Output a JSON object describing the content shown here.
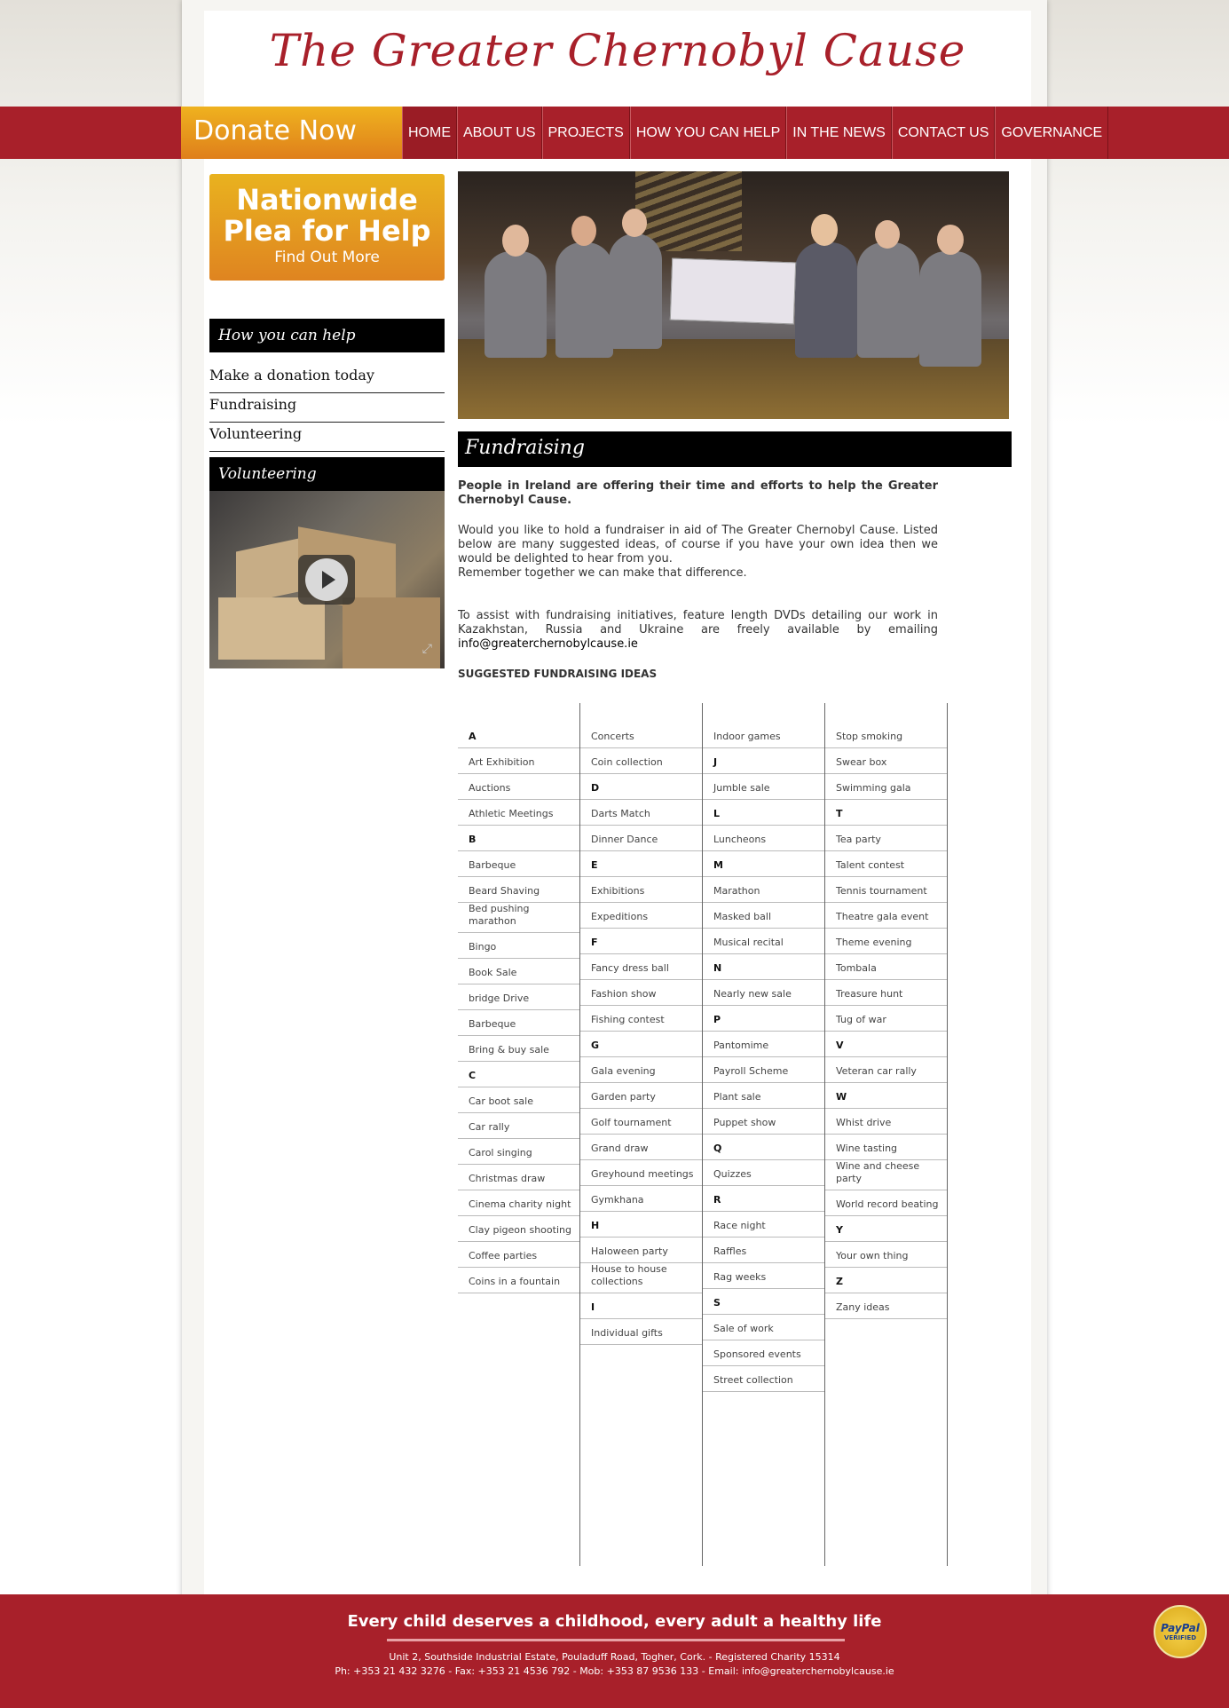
{
  "header": {
    "site_title": "The Greater Chernobyl Cause"
  },
  "nav": {
    "donate_label": "Donate Now",
    "items": [
      "HOME",
      "ABOUT US",
      "PROJECTS",
      "HOW YOU CAN HELP",
      "IN THE NEWS",
      "CONTACT US",
      "GOVERNANCE"
    ],
    "active": "HOME"
  },
  "sidebar": {
    "plea": {
      "title_line1": "Nationwide",
      "title_line2": "Plea for Help",
      "subtitle": "Find Out More"
    },
    "help_heading": "How you can help",
    "links": [
      "Make a donation today",
      "Fundraising",
      "Volunteering"
    ],
    "video_heading": "Volunteering"
  },
  "main": {
    "heading": "Fundraising",
    "lead": "People in Ireland are offering their time and efforts to help the Greater Chernobyl Cause.",
    "para1": "Would you like to hold a fundraiser in aid of The Greater Chernobyl Cause. Listed below are many suggested ideas, of course if you have your own idea then we would be delighted to hear from you.",
    "para2": "Remember together we can make that difference.",
    "para3": "To assist with fundraising initiatives, feature length DVDs detailing our work in Kazakhstan, Russia and Ukraine are freely available by emailing",
    "email": "info@greaterchernobylcause.ie",
    "ideas_title": "SUGGESTED FUNDRAISING IDEAS",
    "ideas_columns": [
      [
        "A",
        "Art Exhibition",
        "Auctions",
        "Athletic Meetings",
        "B",
        "Barbeque",
        "Beard Shaving",
        "Bed pushing marathon",
        "Bingo",
        "Book Sale",
        "bridge Drive",
        "Barbeque",
        "Bring & buy sale",
        "C",
        "Car boot sale",
        "Car rally",
        "Carol singing",
        "Christmas draw",
        "Cinema charity night",
        "Clay pigeon shooting",
        "Coffee parties",
        "Coins in a fountain"
      ],
      [
        "Concerts",
        "Coin collection",
        "D",
        "Darts Match",
        "Dinner Dance",
        "E",
        "Exhibitions",
        "Expeditions",
        "F",
        "Fancy dress ball",
        "Fashion show",
        "Fishing contest",
        "G",
        "Gala evening",
        "Garden party",
        "Golf tournament",
        "Grand draw",
        "Greyhound meetings",
        "Gymkhana",
        "H",
        "Haloween party",
        "House to house collections",
        "I",
        "Individual gifts"
      ],
      [
        "Indoor games",
        "J",
        "Jumble sale",
        "L",
        "Luncheons",
        "M",
        "Marathon",
        "Masked ball",
        "Musical recital",
        "N",
        "Nearly new sale",
        "P",
        "Pantomime",
        "Payroll Scheme",
        "Plant sale",
        "Puppet show",
        "Q",
        "Quizzes",
        "R",
        "Race night",
        "Raffles",
        "Rag weeks",
        "S",
        "Sale of work",
        "Sponsored events",
        "Street collection"
      ],
      [
        "Stop smoking",
        "Swear box",
        "Swimming gala",
        "T",
        "Tea party",
        "Talent contest",
        "Tennis tournament",
        "Theatre gala event",
        "Theme evening",
        "Tombala",
        "Treasure hunt",
        "Tug of war",
        "V",
        "Veteran car rally",
        "W",
        "Whist drive",
        "Wine tasting",
        "Wine and cheese party",
        "World record beating",
        "Y",
        "Your own thing",
        "Z",
        "Zany ideas"
      ]
    ]
  },
  "footer": {
    "slogan": "Every child deserves a childhood, every adult a healthy life",
    "address": "Unit 2, Southside Industrial Estate, Pouladuff Road, Togher, Cork. - Registered Charity 15314",
    "phones": "Ph: +353 21 432 3276 - Fax: +353 21 4536 792 - Mob: +353 87 9536 133 - Email: info@greaterchernobylcause.ie",
    "paypal_label": "PayPal",
    "paypal_verified": "VERIFIED"
  },
  "colors": {
    "brand_red": "#a8202a",
    "orange": "#e28c1e"
  }
}
